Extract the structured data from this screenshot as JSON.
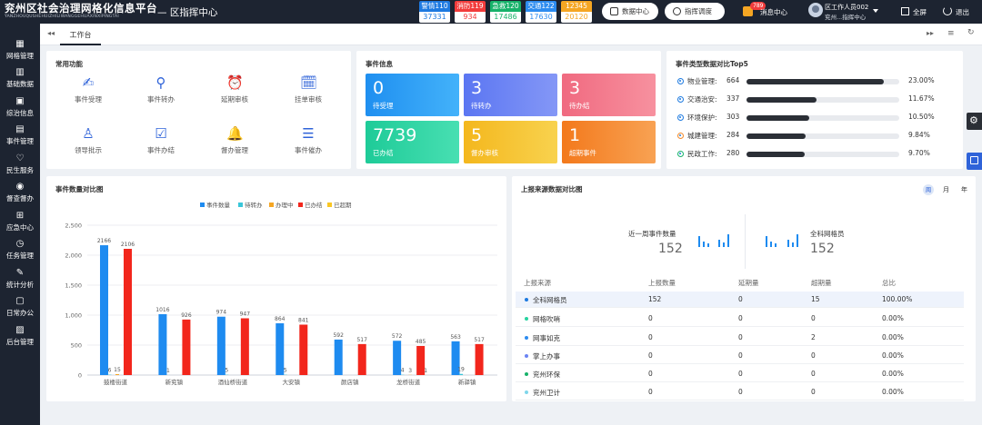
{
  "header": {
    "app_title": "兖州区社会治理网格化信息平台",
    "app_subtitle": "YANZHOUQUSHEHUIZHILIWANGGEHUAXINXIPINGTAI",
    "center_name": "— 区指挥中心",
    "stats": [
      {
        "label": "警情110",
        "value": "37331",
        "color": "#1e7ae0"
      },
      {
        "label": "消防119",
        "value": "934",
        "color": "#f23c3c"
      },
      {
        "label": "急救120",
        "value": "17486",
        "color": "#17b26a"
      },
      {
        "label": "交通122",
        "value": "17630",
        "color": "#2d8cf0"
      },
      {
        "label": "12345",
        "value": "20120",
        "color": "#f5a623"
      }
    ],
    "data_center_btn": "数据中心",
    "dispatch_btn": "指挥调度",
    "message_badge": "789",
    "message_label": "消息中心",
    "user_name": "区工作人员002",
    "user_org": "兖州...指挥中心",
    "fullscreen_label": "全屏",
    "logout_label": "退出"
  },
  "sidebar": {
    "items": [
      {
        "label": "网格管理",
        "icon": "grid-icon"
      },
      {
        "label": "基础数据",
        "icon": "bar-chart-icon"
      },
      {
        "label": "综治信息",
        "icon": "monitor-icon"
      },
      {
        "label": "事件管理",
        "icon": "clipboard-icon"
      },
      {
        "label": "民生服务",
        "icon": "heart-icon"
      },
      {
        "label": "督查督办",
        "icon": "eye-icon"
      },
      {
        "label": "应急中心",
        "icon": "apps-icon"
      },
      {
        "label": "任务管理",
        "icon": "clock-icon"
      },
      {
        "label": "统计分析",
        "icon": "edit-icon"
      },
      {
        "label": "日常办公",
        "icon": "user-card-icon"
      },
      {
        "label": "后台管理",
        "icon": "image-icon"
      }
    ]
  },
  "tabs": {
    "active": "工作台"
  },
  "common_functions": {
    "title": "常用功能",
    "items": [
      {
        "label": "事件受理",
        "icon": "edit-doc-icon"
      },
      {
        "label": "事件转办",
        "icon": "share-nodes-icon"
      },
      {
        "label": "延期审核",
        "icon": "alarm-clock-icon"
      },
      {
        "label": "挂单审核",
        "icon": "calendar-check-icon"
      },
      {
        "label": "领导批示",
        "icon": "user-edit-icon"
      },
      {
        "label": "事件办结",
        "icon": "calendar-done-icon"
      },
      {
        "label": "督办管理",
        "icon": "bell-icon"
      },
      {
        "label": "事件催办",
        "icon": "document-list-icon"
      }
    ]
  },
  "event_info": {
    "title": "事件信息",
    "tiles": [
      {
        "value": "0",
        "label": "待受理",
        "color": "#2f9cf4"
      },
      {
        "value": "3",
        "label": "待转办",
        "color": "#6b84f3"
      },
      {
        "value": "3",
        "label": "待办结",
        "color": "#f2788a"
      },
      {
        "value": "7739",
        "label": "已办结",
        "color": "#27d3a0"
      },
      {
        "value": "5",
        "label": "督办审核",
        "color": "#f5c326"
      },
      {
        "value": "1",
        "label": "超期事件",
        "color": "#f48a2a"
      }
    ]
  },
  "top5": {
    "title": "事件类型数据对比Top5",
    "rows": [
      {
        "name": "物业管理:",
        "value": "664",
        "pct": "23.00%",
        "ratio": 0.23,
        "color": "#1e7ae0"
      },
      {
        "name": "交通治安:",
        "value": "337",
        "pct": "11.67%",
        "ratio": 0.1167,
        "color": "#2dbdf0"
      },
      {
        "name": "环境保护:",
        "value": "303",
        "pct": "10.50%",
        "ratio": 0.105,
        "color": "#1e7ae0"
      },
      {
        "name": "城建管理:",
        "value": "284",
        "pct": "9.84%",
        "ratio": 0.0984,
        "color": "#f48a2a"
      },
      {
        "name": "民政工作:",
        "value": "280",
        "pct": "9.70%",
        "ratio": 0.097,
        "color": "#17b26a"
      }
    ]
  },
  "chart_data": {
    "type": "bar",
    "title": "事件数量对比图",
    "categories": [
      "鼓楼街道",
      "新兖镇",
      "酒仙桥街道",
      "大安镇",
      "颜店镇",
      "龙桥街道",
      "新驿镇"
    ],
    "ylim": [
      0,
      2500
    ],
    "yticks": [
      "0",
      "500",
      "1,000",
      "1,500",
      "2,000",
      "2,500"
    ],
    "legend_placement": "top-center",
    "series": [
      {
        "name": "事件数量",
        "color": "#1e8bf0",
        "values": [
          2166,
          1016,
          974,
          864,
          592,
          572,
          563
        ],
        "labels": [
          "2166",
          "1016",
          "974",
          "864",
          "592",
          "572",
          "563"
        ]
      },
      {
        "name": "待转办",
        "color": "#39c6d9",
        "values": [
          6,
          1,
          5,
          5,
          0,
          4,
          19
        ],
        "labels": [
          "6",
          "1",
          "5",
          "5",
          "",
          "4",
          "19"
        ]
      },
      {
        "name": "办理中",
        "color": "#f5a623",
        "values": [
          15,
          0,
          0,
          0,
          0,
          3,
          0
        ],
        "labels": [
          "15",
          "",
          "",
          "",
          "",
          "3",
          ""
        ]
      },
      {
        "name": "已办结",
        "color": "#f2261c",
        "values": [
          2106,
          926,
          947,
          841,
          517,
          485,
          517
        ],
        "labels": [
          "2106",
          "926",
          "947",
          "841",
          "517",
          "485",
          "517"
        ]
      },
      {
        "name": "已超期",
        "color": "#f9c623",
        "values": [
          0,
          0,
          0,
          0,
          0,
          1,
          0
        ],
        "labels": [
          "",
          "",
          "",
          "",
          "",
          "1",
          ""
        ]
      }
    ]
  },
  "source_compare": {
    "title": "上报来源数据对比图",
    "period_tabs": [
      "周",
      "月",
      "年"
    ],
    "week_count_label": "近一周事件数量",
    "week_count_value": "152",
    "grid_member_label": "全科网格员",
    "grid_member_value": "152",
    "columns": [
      "上报来源",
      "上报数量",
      "延期量",
      "超期量",
      "总比"
    ],
    "rows": [
      {
        "source": "全科网格员",
        "reported": "152",
        "delayed": "0",
        "overdue": "15",
        "ratio": "100.00%",
        "dot": "#1e7ae0"
      },
      {
        "source": "网格吹哨",
        "reported": "0",
        "delayed": "0",
        "overdue": "0",
        "ratio": "0.00%",
        "dot": "#27d3a0"
      },
      {
        "source": "网事如克",
        "reported": "0",
        "delayed": "0",
        "overdue": "2",
        "ratio": "0.00%",
        "dot": "#2d8cf0"
      },
      {
        "source": "掌上办事",
        "reported": "0",
        "delayed": "0",
        "overdue": "0",
        "ratio": "0.00%",
        "dot": "#6b84f3"
      },
      {
        "source": "兖州环保",
        "reported": "0",
        "delayed": "0",
        "overdue": "0",
        "ratio": "0.00%",
        "dot": "#17b26a"
      },
      {
        "source": "兖州卫计",
        "reported": "0",
        "delayed": "0",
        "overdue": "0",
        "ratio": "0.00%",
        "dot": "#7fd6ea"
      }
    ]
  }
}
